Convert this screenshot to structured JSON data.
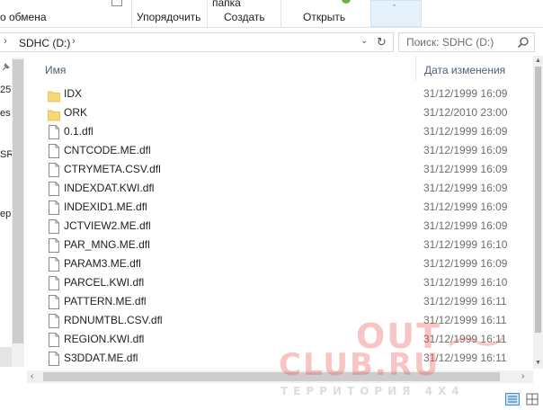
{
  "ribbon": {
    "clipboard_fragment": "о обмена",
    "organize_label": "Упорядочить",
    "new_label": "Создать",
    "new_folder_fragment": "папка",
    "open_label": "Открыть"
  },
  "address": {
    "path": "SDHC (D:)",
    "search_placeholder": "Поиск: SDHC (D:)"
  },
  "nav": {
    "fragments": [
      "25'",
      "es",
      "SR",
      "ер"
    ]
  },
  "columns": {
    "name": "Имя",
    "date": "Дата изменения"
  },
  "files": [
    {
      "name": "IDX",
      "date": "31/12/1999 16:09",
      "type": "folder"
    },
    {
      "name": "ORK",
      "date": "31/12/2010 23:00",
      "type": "folder"
    },
    {
      "name": "0.1.dfl",
      "date": "31/12/1999 16:09",
      "type": "file"
    },
    {
      "name": "CNTCODE.ME.dfl",
      "date": "31/12/1999 16:09",
      "type": "file"
    },
    {
      "name": "CTRYMETA.CSV.dfl",
      "date": "31/12/1999 16:09",
      "type": "file"
    },
    {
      "name": "INDEXDAT.KWI.dfl",
      "date": "31/12/1999 16:09",
      "type": "file"
    },
    {
      "name": "INDEXID1.ME.dfl",
      "date": "31/12/1999 16:09",
      "type": "file"
    },
    {
      "name": "JCTVIEW2.ME.dfl",
      "date": "31/12/1999 16:09",
      "type": "file"
    },
    {
      "name": "PAR_MNG.ME.dfl",
      "date": "31/12/1999 16:10",
      "type": "file"
    },
    {
      "name": "PARAM3.ME.dfl",
      "date": "31/12/1999 16:09",
      "type": "file"
    },
    {
      "name": "PARCEL.KWI.dfl",
      "date": "31/12/1999 16:10",
      "type": "file"
    },
    {
      "name": "PATTERN.ME.dfl",
      "date": "31/12/1999 16:11",
      "type": "file"
    },
    {
      "name": "RDNUMTBL.CSV.dfl",
      "date": "31/12/1999 16:11",
      "type": "file"
    },
    {
      "name": "REGION.KWI.dfl",
      "date": "31/12/1999 16:11",
      "type": "file"
    },
    {
      "name": "S3DDAT.ME.dfl",
      "date": "31/12/1999 16:11",
      "type": "file"
    }
  ],
  "watermark": {
    "line1": "OUT",
    "line2": "CLUB.RU",
    "line3": "ТЕРРИТОРИЯ 4X4"
  },
  "colors": {
    "folder": "#f8d775",
    "folder_edge": "#e0b84a",
    "accent": "#3c8fd6",
    "header_text": "#4c607a"
  }
}
